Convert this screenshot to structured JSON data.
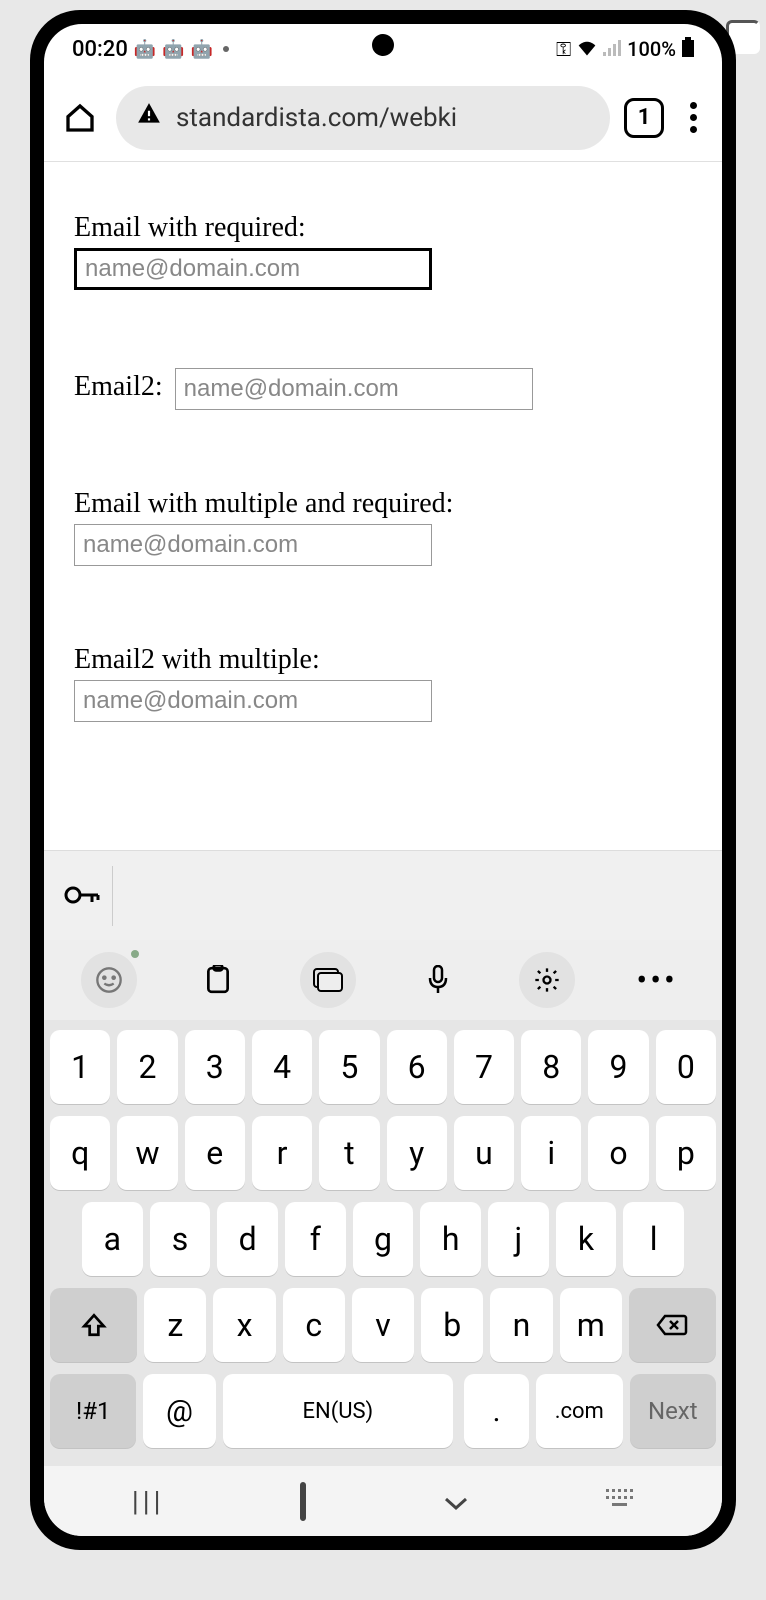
{
  "status": {
    "time": "00:20",
    "battery": "100%"
  },
  "browser": {
    "url": "standardista.com/webki",
    "tab_count": "1"
  },
  "form": {
    "fields": [
      {
        "label": "Email with required:",
        "placeholder": "name@domain.com",
        "focused": true,
        "inline": false
      },
      {
        "label": "Email2:",
        "placeholder": "name@domain.com",
        "focused": false,
        "inline": true
      },
      {
        "label": "Email with multiple and required:",
        "placeholder": "name@domain.com",
        "focused": false,
        "inline": false
      },
      {
        "label": "Email2 with multiple:",
        "placeholder": "name@domain.com",
        "focused": false,
        "inline": false
      }
    ]
  },
  "keyboard": {
    "row1": [
      "1",
      "2",
      "3",
      "4",
      "5",
      "6",
      "7",
      "8",
      "9",
      "0"
    ],
    "row2": [
      "q",
      "w",
      "e",
      "r",
      "t",
      "y",
      "u",
      "i",
      "o",
      "p"
    ],
    "row3": [
      "a",
      "s",
      "d",
      "f",
      "g",
      "h",
      "j",
      "k",
      "l"
    ],
    "row4": [
      "z",
      "x",
      "c",
      "v",
      "b",
      "n",
      "m"
    ],
    "sym": "!#1",
    "at": "@",
    "space": "EN(US)",
    "period": ".",
    "com": ".com",
    "next": "Next"
  }
}
